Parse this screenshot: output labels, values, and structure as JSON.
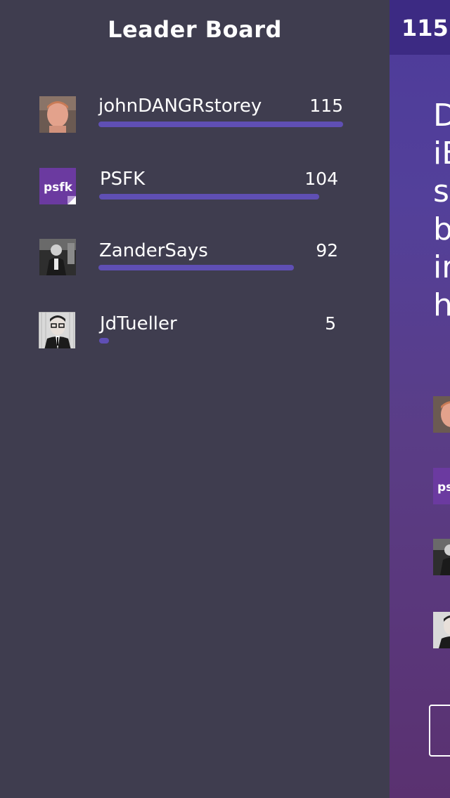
{
  "leaderboard": {
    "title": "Leader Board",
    "entries": [
      {
        "name": "johnDANGRstorey",
        "score": "115",
        "fraction": 1.0,
        "avatar": "photo-man-ginger"
      },
      {
        "name": "PSFK",
        "score": "104",
        "fraction": 0.9,
        "avatar": "psfk-logo",
        "logo_text": "psfk"
      },
      {
        "name": "ZanderSays",
        "score": "92",
        "fraction": 0.8,
        "avatar": "photo-man-suit-bw"
      },
      {
        "name": "JdTueller",
        "score": "5",
        "fraction": 0.04,
        "avatar": "photo-man-glasses-bw"
      }
    ]
  },
  "game_panel": {
    "score": "115",
    "question_lines": [
      "D",
      "iE",
      "sl",
      "b",
      "ir",
      "h"
    ]
  },
  "colors": {
    "panel_bg": "#3f3d4f",
    "bar": "#5f4fb4",
    "score_header": "#3c2a83",
    "psfk_purple": "#6b3aa0"
  }
}
